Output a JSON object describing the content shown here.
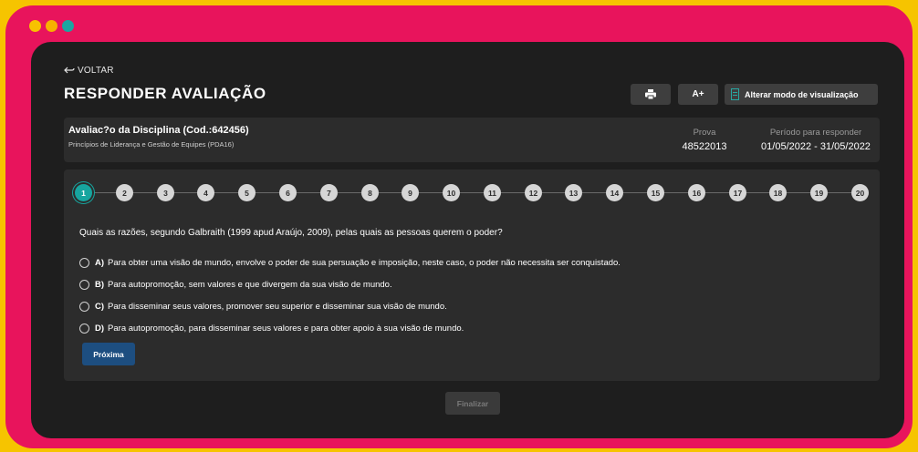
{
  "window": {
    "dot_colors": [
      "#f8c200",
      "#f7b100",
      "#1aa6a1"
    ]
  },
  "header": {
    "back_label": "VOLTAR",
    "title": "RESPONDER AVALIAÇÃO",
    "font_button_label": "A+",
    "view_mode_label": "Alterar modo de visualização"
  },
  "info": {
    "discipline": "Avaliac?o da Disciplina (Cod.:642456)",
    "course": "Princípios de Liderança e Gestão de Equipes (PDA16)",
    "prova_label": "Prova",
    "prova_value": "48522013",
    "period_label": "Período para responder",
    "period_value": "01/05/2022 - 31/05/2022"
  },
  "steps": [
    "1",
    "2",
    "3",
    "4",
    "5",
    "6",
    "7",
    "8",
    "9",
    "10",
    "11",
    "12",
    "13",
    "14",
    "15",
    "16",
    "17",
    "18",
    "19",
    "20"
  ],
  "active_step": 1,
  "question": {
    "text": "Quais as razões, segundo Galbraith (1999 apud Araújo, 2009), pelas quais as pessoas querem o poder?",
    "options": [
      {
        "letter": "A)",
        "text": "Para obter uma visão de mundo, envolve o poder de sua persuação e imposição, neste caso, o poder não necessita ser conquistado."
      },
      {
        "letter": "B)",
        "text": "Para autopromoção, sem valores e que divergem da sua visão de mundo."
      },
      {
        "letter": "C)",
        "text": "Para disseminar seus valores, promover seu superior e disseminar sua visão de mundo."
      },
      {
        "letter": "D)",
        "text": "Para autopromoção, para disseminar seus valores e para obter apoio à sua visão de mundo."
      }
    ]
  },
  "buttons": {
    "next_label": "Próxima",
    "finish_label": "Finalizar"
  },
  "colors": {
    "accent": "#17a59f",
    "primary_button": "#1d4e80",
    "frame": "#e8145c",
    "background": "#f6c400"
  }
}
